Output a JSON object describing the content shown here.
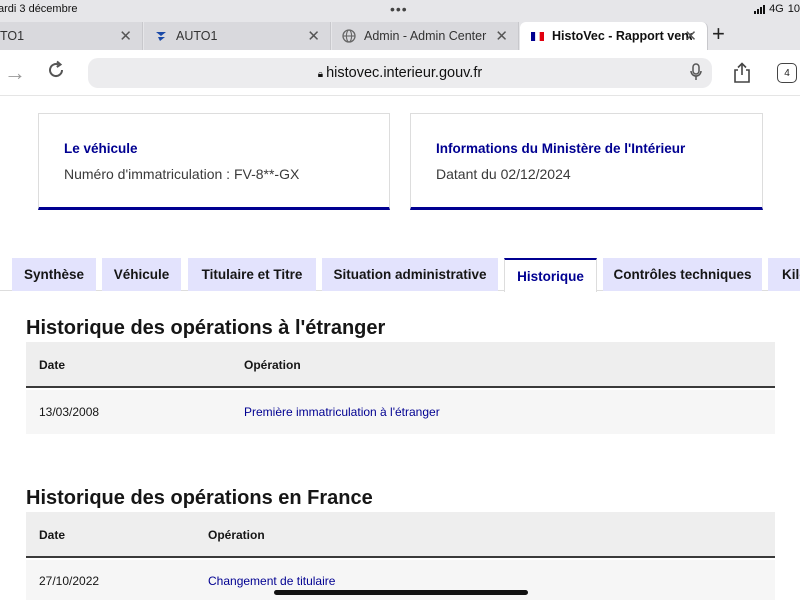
{
  "status_bar": {
    "date": "ardi 3 décembre",
    "network": "4G",
    "battery_partial": "10"
  },
  "browser": {
    "tabs": [
      {
        "title": "TO1",
        "favicon": "none"
      },
      {
        "title": "AUTO1",
        "favicon": "auto1-logo-icon"
      },
      {
        "title": "Admin - Admin Center",
        "favicon": "globe-icon"
      },
      {
        "title": "HistoVec - Rapport vende",
        "favicon": "french-flag-icon",
        "active": true
      }
    ],
    "url": "histovec.interieur.gouv.fr",
    "tab_count": "4"
  },
  "cards": [
    {
      "title": "Le véhicule",
      "text": "Numéro d'immatriculation : FV-8**-GX"
    },
    {
      "title": "Informations du Ministère de l'Intérieur",
      "text": "Datant du 02/12/2024"
    }
  ],
  "page_tabs": [
    {
      "label": "Synthèse"
    },
    {
      "label": "Véhicule"
    },
    {
      "label": "Titulaire et Titre"
    },
    {
      "label": "Situation administrative"
    },
    {
      "label": "Historique",
      "active": true
    },
    {
      "label": "Contrôles techniques"
    },
    {
      "label": "Kilo"
    }
  ],
  "sections": [
    {
      "title": "Historique des opérations à l'étranger",
      "headers": {
        "date": "Date",
        "operation": "Opération"
      },
      "rows": [
        {
          "date": "13/03/2008",
          "operation": "Première immatriculation à l'étranger"
        }
      ]
    },
    {
      "title": "Historique des opérations en France",
      "headers": {
        "date": "Date",
        "operation": "Opération"
      },
      "rows": [
        {
          "date": "27/10/2022",
          "operation": "Changement de titulaire"
        }
      ]
    }
  ],
  "colors": {
    "accent": "#000091",
    "tab_bg": "#e3e3fd",
    "table_head_bg": "#eeeeee",
    "table_row_bg": "#f6f6f6"
  }
}
